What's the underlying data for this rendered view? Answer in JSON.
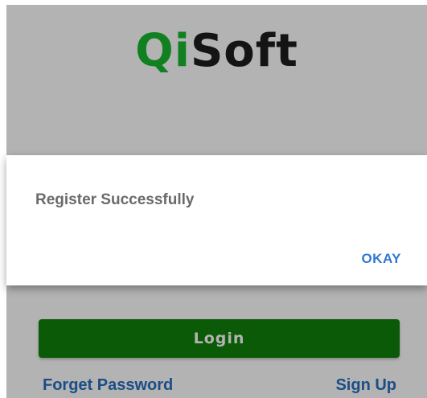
{
  "app": {
    "logo_part1": "Qi",
    "logo_part2": "Soft",
    "logo_colors": {
      "qi": "#118020",
      "soft": "#141414"
    }
  },
  "dialog": {
    "message": "Register Successfully",
    "confirm_label": "OKAY"
  },
  "login": {
    "button_label": "Login",
    "button_color": "#0b5a08",
    "forget_password_label": "Forget Password",
    "sign_up_label": "Sign Up",
    "link_color": "#1b4d86"
  },
  "overlay_color": "#b3b3b3"
}
